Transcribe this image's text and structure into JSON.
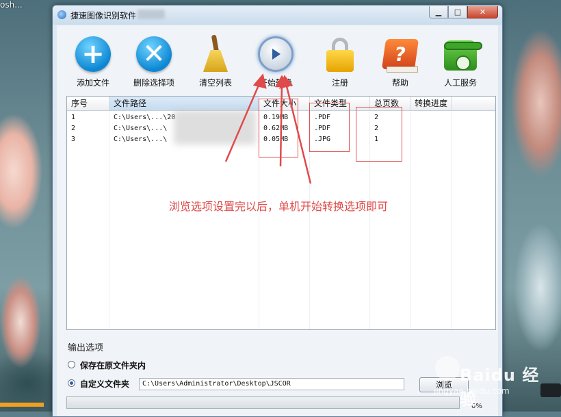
{
  "desktop": {
    "icon_text": "osh..."
  },
  "window": {
    "title": "捷速图像识别软件",
    "buttons": [
      "minimize",
      "maximize",
      "close"
    ]
  },
  "toolbar": [
    {
      "label": "添加文件",
      "icon": "add-icon"
    },
    {
      "label": "删除选择项",
      "icon": "delete-icon"
    },
    {
      "label": "清空列表",
      "icon": "broom-icon"
    },
    {
      "label": "开始转换",
      "icon": "play-icon"
    },
    {
      "label": "注册",
      "icon": "lock-icon"
    },
    {
      "label": "帮助",
      "icon": "help-book-icon"
    },
    {
      "label": "人工服务",
      "icon": "phone-icon"
    }
  ],
  "grid": {
    "columns": [
      "序号",
      "文件路径",
      "文件大小",
      "文件类型",
      "总页数",
      "转换进度"
    ],
    "rows": [
      [
        "1",
        "C:\\Users\\...\\20",
        "0.19MB",
        ".PDF",
        "2",
        ""
      ],
      [
        "2",
        "C:\\Users\\...\\",
        "0.62MB",
        ".PDF",
        "2",
        ""
      ],
      [
        "3",
        "C:\\Users\\...\\",
        "0.05MB",
        ".JPG",
        "1",
        ""
      ]
    ]
  },
  "annotation": {
    "text": "浏览选项设置完以后，单机开始转换选项即可",
    "color": "#e04a4a"
  },
  "output": {
    "section_title": "输出选项",
    "option_original": "保存在原文件夹内",
    "option_custom": "自定义文件夹",
    "selected": "custom",
    "path": "C:\\Users\\Administrator\\Desktop\\JSCOR",
    "browse_label": "浏览",
    "progress_percent": "0%",
    "progress_value": 0
  },
  "watermark": {
    "text": "Baidu 经验",
    "sub": "jingyan.baidu.com"
  }
}
